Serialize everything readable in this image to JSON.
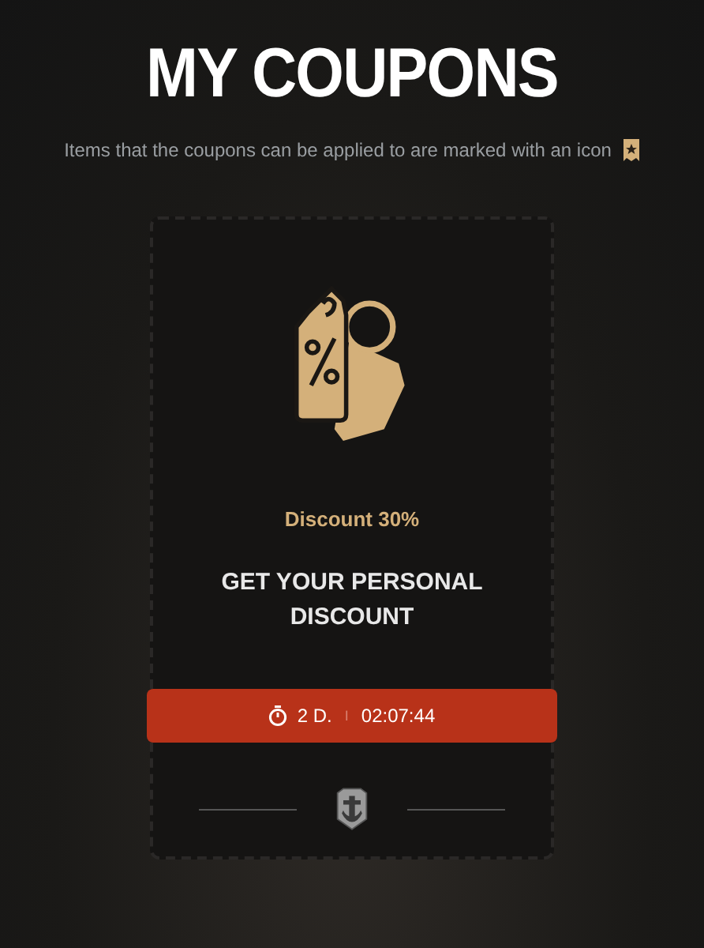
{
  "page": {
    "title": "MY COUPONS",
    "subtitle": "Items that the coupons can be applied to are marked with an icon"
  },
  "coupon": {
    "discount": "Discount 30%",
    "heading": "GET YOUR PERSONAL DISCOUNT",
    "timer": {
      "days": "2 D.",
      "separator": "I",
      "time": "02:07:44"
    }
  }
}
